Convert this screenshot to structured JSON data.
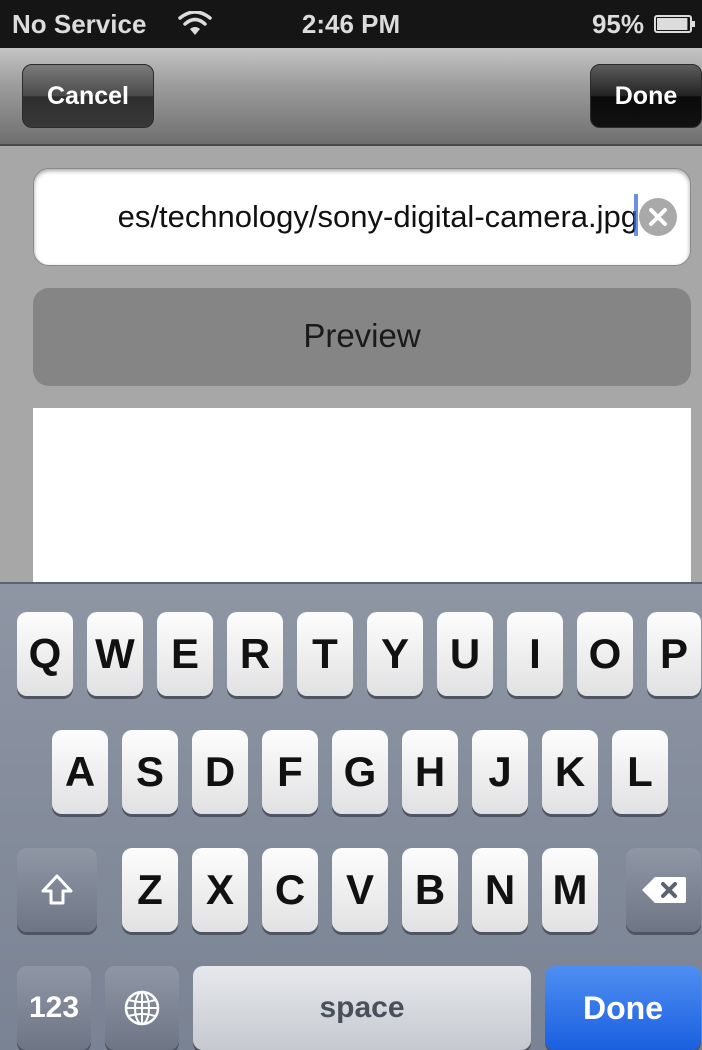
{
  "status_bar": {
    "carrier": "No Service",
    "time": "2:46 PM",
    "battery": "95%",
    "battery_level": 0.95,
    "icons": [
      "wifi-icon",
      "battery-icon"
    ]
  },
  "nav_bar": {
    "cancel_label": "Cancel",
    "done_label": "Done"
  },
  "url_field": {
    "value": "es/technology/sony-digital-camera.jpg",
    "clear_icon": "clear-icon"
  },
  "preview_button": {
    "label": "Preview"
  },
  "keyboard": {
    "row1": [
      "Q",
      "W",
      "E",
      "R",
      "T",
      "Y",
      "U",
      "I",
      "O",
      "P"
    ],
    "row2": [
      "A",
      "S",
      "D",
      "F",
      "G",
      "H",
      "J",
      "K",
      "L"
    ],
    "row3": [
      "Z",
      "X",
      "C",
      "V",
      "B",
      "N",
      "M"
    ],
    "numbers_label": "123",
    "space_label": "space",
    "done_label": "Done",
    "icons": [
      "shift-icon",
      "delete-icon",
      "globe-icon"
    ]
  },
  "colors": {
    "keyboard_bg": "#7a8393",
    "done_key": "#1a5fe0",
    "status_bar_bg": "#151515"
  }
}
